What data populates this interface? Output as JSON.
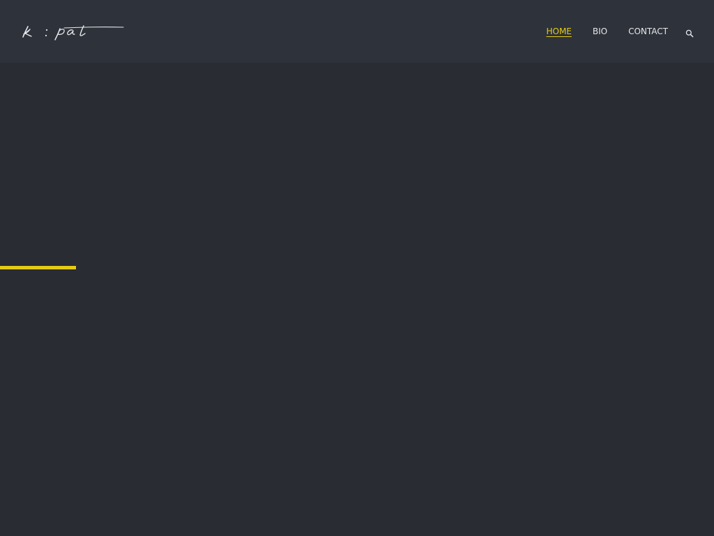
{
  "colors": {
    "background": "#292c33",
    "header_background": "#2e323a",
    "accent": "#e5cc14",
    "nav_text": "#e6e7ea"
  },
  "header": {
    "logo": {
      "text": "k:pat",
      "icon": "signature-logo"
    },
    "nav": {
      "items": [
        {
          "label": "HOME",
          "active": true
        },
        {
          "label": "BIO",
          "active": false
        },
        {
          "label": "CONTACT",
          "active": false
        }
      ],
      "search_icon": "search-icon"
    }
  },
  "main": {
    "progress_bar": {
      "fraction": 0.106
    }
  }
}
